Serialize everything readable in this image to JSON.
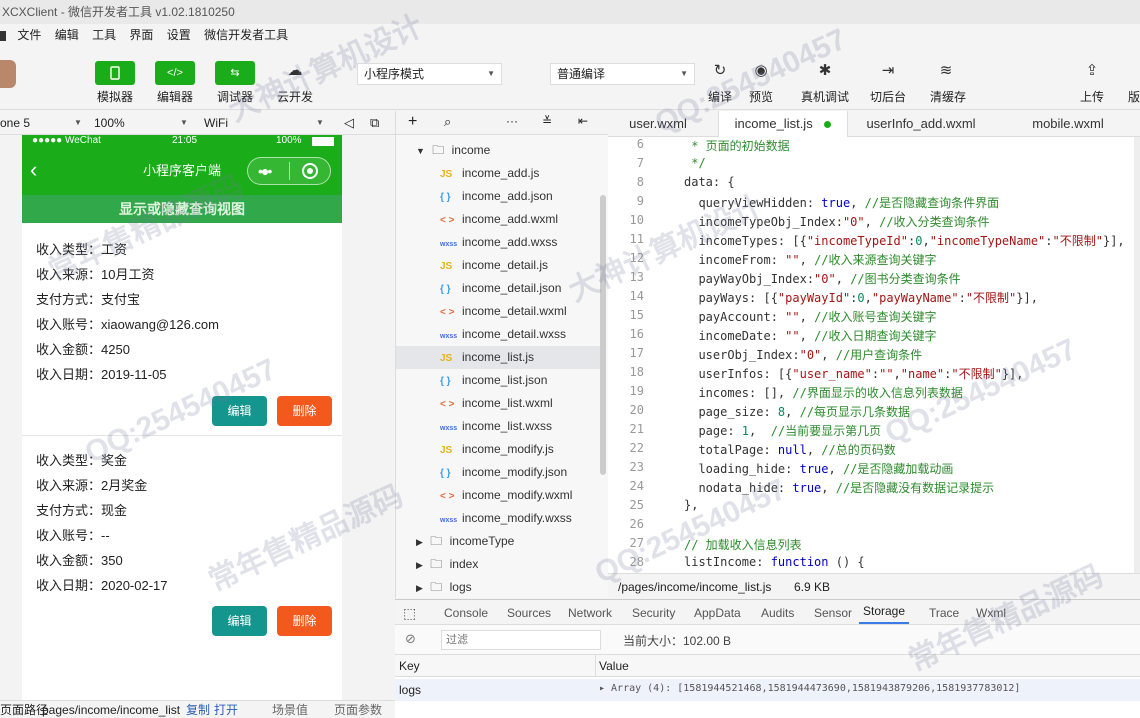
{
  "window": {
    "title": "XCXClient - 微信开发者工具 v1.02.1810250"
  },
  "menu": [
    "文件",
    "编辑",
    "工具",
    "界面",
    "设置",
    "微信开发者工具"
  ],
  "toolbar": {
    "simulator": "模拟器",
    "editor": "编辑器",
    "debugger": "调试器",
    "cloud": "云开发",
    "mode_select": "小程序模式",
    "compile_select": "普通编译",
    "compile": "编译",
    "preview": "预览",
    "real_debug": "真机调试",
    "background": "切后台",
    "clear_cache": "清缓存",
    "upload": "上传",
    "version": "版"
  },
  "simulator": {
    "device": "one 5",
    "zoom": "100%",
    "network": "WiFi",
    "status_carrier": "●●●●● WeChat",
    "status_time": "21:05",
    "status_battery": "100%",
    "nav_title": "小程序客户端",
    "query_toggle": "显示或隐藏查询视图",
    "records": [
      {
        "type": "收入类型：工资",
        "source": "收入来源：10月工资",
        "payway": "支付方式：支付宝",
        "account": "收入账号：xiaowang@126.com",
        "amount": "收入金额：4250",
        "date": "收入日期：2019-11-05",
        "edit": "编辑",
        "delete": "删除"
      },
      {
        "type": "收入类型：奖金",
        "source": "收入来源：2月奖金",
        "payway": "支付方式：现金",
        "account": "收入账号：--",
        "amount": "收入金额：350",
        "date": "收入日期：2020-02-17",
        "edit": "编辑",
        "delete": "删除"
      }
    ],
    "bottom_path_label": "页面路径",
    "bottom_path": "pages/income/income_list",
    "copy": "复制",
    "open": "打开",
    "scene": "场景值",
    "params": "页面参数"
  },
  "filetree": {
    "folder_open": "income",
    "files": [
      {
        "icon": "JS",
        "kind": "js",
        "name": "income_add.js"
      },
      {
        "icon": "{ }",
        "kind": "json",
        "name": "income_add.json"
      },
      {
        "icon": "< >",
        "kind": "wxml",
        "name": "income_add.wxml"
      },
      {
        "icon": "wxss",
        "kind": "wxss",
        "name": "income_add.wxss"
      },
      {
        "icon": "JS",
        "kind": "js",
        "name": "income_detail.js"
      },
      {
        "icon": "{ }",
        "kind": "json",
        "name": "income_detail.json"
      },
      {
        "icon": "< >",
        "kind": "wxml",
        "name": "income_detail.wxml"
      },
      {
        "icon": "wxss",
        "kind": "wxss",
        "name": "income_detail.wxss"
      },
      {
        "icon": "JS",
        "kind": "js",
        "name": "income_list.js"
      },
      {
        "icon": "{ }",
        "kind": "json",
        "name": "income_list.json"
      },
      {
        "icon": "< >",
        "kind": "wxml",
        "name": "income_list.wxml"
      },
      {
        "icon": "wxss",
        "kind": "wxss",
        "name": "income_list.wxss"
      },
      {
        "icon": "JS",
        "kind": "js",
        "name": "income_modify.js"
      },
      {
        "icon": "{ }",
        "kind": "json",
        "name": "income_modify.json"
      },
      {
        "icon": "< >",
        "kind": "wxml",
        "name": "income_modify.wxml"
      },
      {
        "icon": "wxss",
        "kind": "wxss",
        "name": "income_modify.wxss"
      }
    ],
    "folders_closed": [
      "incomeType",
      "index",
      "logs"
    ]
  },
  "editor": {
    "tabs": [
      "user.wxml",
      "income_list.js",
      "userInfo_add.wxml",
      "mobile.wxml"
    ],
    "active_tab": "income_list.js",
    "lines": [
      {
        "n": "6",
        "html": "<span class='cm'> * 页面的初始数据</span>"
      },
      {
        "n": "7",
        "html": "<span class='cm'> */</span>"
      },
      {
        "n": "8",
        "html": "data: {"
      },
      {
        "n": "9",
        "html": "  queryViewHidden: <span class='kw'>true</span>, <span class='cm'>//是否隐藏查询条件界面</span>"
      },
      {
        "n": "10",
        "html": "  incomeTypeObj_Index:<span class='st'>\"0\"</span>, <span class='cm'>//收入分类查询条件</span>"
      },
      {
        "n": "11",
        "html": "  incomeTypes: [{<span class='st'>\"incomeTypeId\"</span>:<span class='nu'>0</span>,<span class='st'>\"incomeTypeName\"</span>:<span class='st'>\"不限制\"</span>}],"
      },
      {
        "n": "12",
        "html": "  incomeFrom: <span class='st'>\"\"</span>, <span class='cm'>//收入来源查询关键字</span>"
      },
      {
        "n": "13",
        "html": "  payWayObj_Index:<span class='st'>\"0\"</span>, <span class='cm'>//图书分类查询条件</span>"
      },
      {
        "n": "14",
        "html": "  payWays: [{<span class='st'>\"payWayId\"</span>:<span class='nu'>0</span>,<span class='st'>\"payWayName\"</span>:<span class='st'>\"不限制\"</span>}],"
      },
      {
        "n": "15",
        "html": "  payAccount: <span class='st'>\"\"</span>, <span class='cm'>//收入账号查询关键字</span>"
      },
      {
        "n": "16",
        "html": "  incomeDate: <span class='st'>\"\"</span>, <span class='cm'>//收入日期查询关键字</span>"
      },
      {
        "n": "17",
        "html": "  userObj_Index:<span class='st'>\"0\"</span>, <span class='cm'>//用户查询条件</span>"
      },
      {
        "n": "18",
        "html": "  userInfos: [{<span class='st'>\"user_name\"</span>:<span class='st'>\"\"</span>,<span class='st'>\"name\"</span>:<span class='st'>\"不限制\"</span>}],"
      },
      {
        "n": "19",
        "html": "  incomes: [], <span class='cm'>//界面显示的收入信息列表数据</span>"
      },
      {
        "n": "20",
        "html": "  page_size: <span class='nu'>8</span>, <span class='cm'>//每页显示几条数据</span>"
      },
      {
        "n": "21",
        "html": "  page: <span class='nu'>1</span>,  <span class='cm'>//当前要显示第几页</span>"
      },
      {
        "n": "22",
        "html": "  totalPage: <span class='kw'>null</span>, <span class='cm'>//总的页码数</span>"
      },
      {
        "n": "23",
        "html": "  loading_hide: <span class='kw'>true</span>, <span class='cm'>//是否隐藏加载动画</span>"
      },
      {
        "n": "24",
        "html": "  nodata_hide: <span class='kw'>true</span>, <span class='cm'>//是否隐藏没有数据记录提示</span>"
      },
      {
        "n": "25",
        "html": "},"
      },
      {
        "n": "26",
        "html": ""
      },
      {
        "n": "27",
        "html": "<span class='cm'>// 加载收入信息列表</span>"
      },
      {
        "n": "28",
        "html": "listIncome: <span class='kw'>function</span> () {"
      }
    ],
    "file_path": "/pages/income/income_list.js",
    "file_size": "6.9 KB"
  },
  "devtools": {
    "tabs": [
      "Console",
      "Sources",
      "Network",
      "Security",
      "AppData",
      "Audits",
      "Sensor",
      "Storage",
      "Trace",
      "Wxml"
    ],
    "active_tab": "Storage",
    "filter_placeholder": "过滤",
    "current_size": "当前大小：102.00 B",
    "col_key": "Key",
    "col_value": "Value",
    "row_key": "logs",
    "row_value": "▸ Array (4): [1581944521468,1581944473690,1581943879206,1581937783012]"
  },
  "watermarks": [
    "QQ:254540457",
    "常年售精品源码",
    "大神计算机设计"
  ]
}
